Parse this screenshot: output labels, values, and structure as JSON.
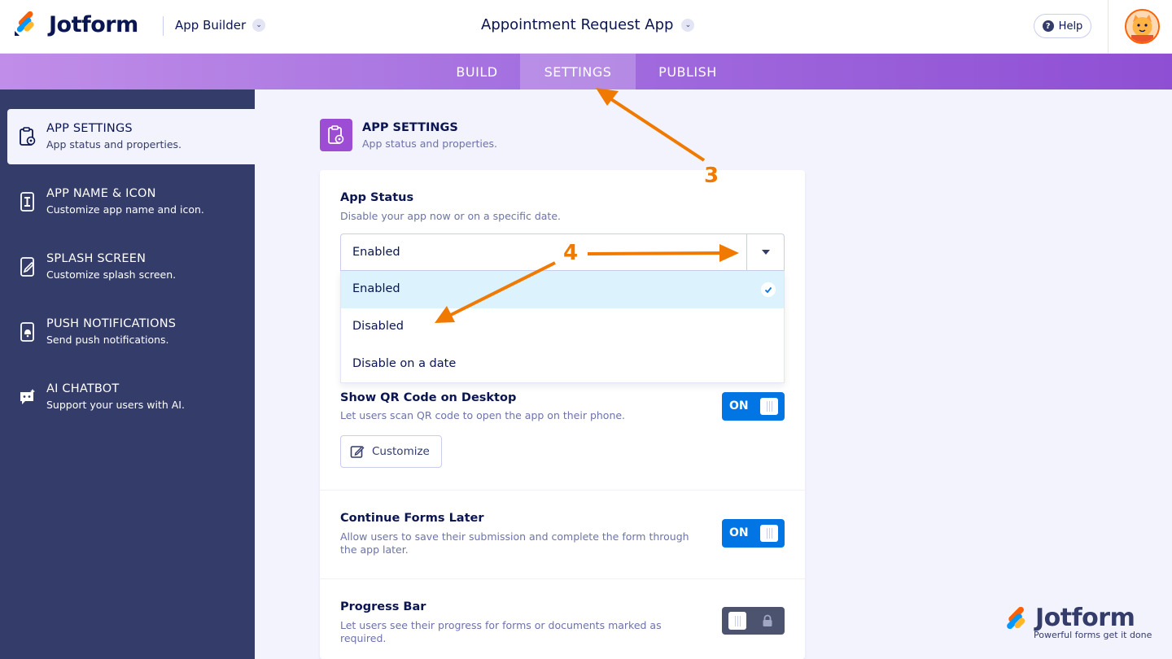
{
  "header": {
    "brand": "Jotform",
    "app_builder_label": "App Builder",
    "app_title": "Appointment Request App",
    "help_label": "Help"
  },
  "tabs": [
    {
      "label": "BUILD"
    },
    {
      "label": "SETTINGS",
      "active": true
    },
    {
      "label": "PUBLISH"
    }
  ],
  "sidebar": {
    "items": [
      {
        "title": "APP SETTINGS",
        "subtitle": "App status and properties.",
        "icon": "settings-clipboard-icon",
        "active": true
      },
      {
        "title": "APP NAME & ICON",
        "subtitle": "Customize app name and icon.",
        "icon": "app-icon"
      },
      {
        "title": "SPLASH SCREEN",
        "subtitle": "Customize splash screen.",
        "icon": "splash-screen-icon"
      },
      {
        "title": "PUSH NOTIFICATIONS",
        "subtitle": "Send push notifications.",
        "icon": "push-notification-icon"
      },
      {
        "title": "AI CHATBOT",
        "subtitle": "Support your users with AI.",
        "icon": "chatbot-icon"
      }
    ]
  },
  "content": {
    "title": "APP SETTINGS",
    "subtitle": "App status and properties.",
    "app_status": {
      "title": "App Status",
      "description": "Disable your app now or on a specific date.",
      "selected": "Enabled",
      "options": [
        "Enabled",
        "Disabled",
        "Disable on a date"
      ]
    },
    "qr_code": {
      "title": "Show QR Code on Desktop",
      "description": "Let users scan QR code to open the app on their phone.",
      "toggle": "ON",
      "customize_label": "Customize"
    },
    "continue_forms": {
      "title": "Continue Forms Later",
      "description": "Allow users to save their submission and complete the form through the app later.",
      "toggle": "ON"
    },
    "progress_bar": {
      "title": "Progress Bar",
      "description": "Let users see their progress for forms or documents marked as required.",
      "toggle": "OFF",
      "locked": true
    }
  },
  "annotations": [
    "3",
    "4"
  ],
  "watermark": {
    "brand": "Jotform",
    "tagline": "Powerful forms get it done"
  },
  "colors": {
    "primary_blue": "#0075e3",
    "sidebar_bg": "#343c6a",
    "purple": "#9c4dd3",
    "annotation_orange": "#f07a00"
  }
}
